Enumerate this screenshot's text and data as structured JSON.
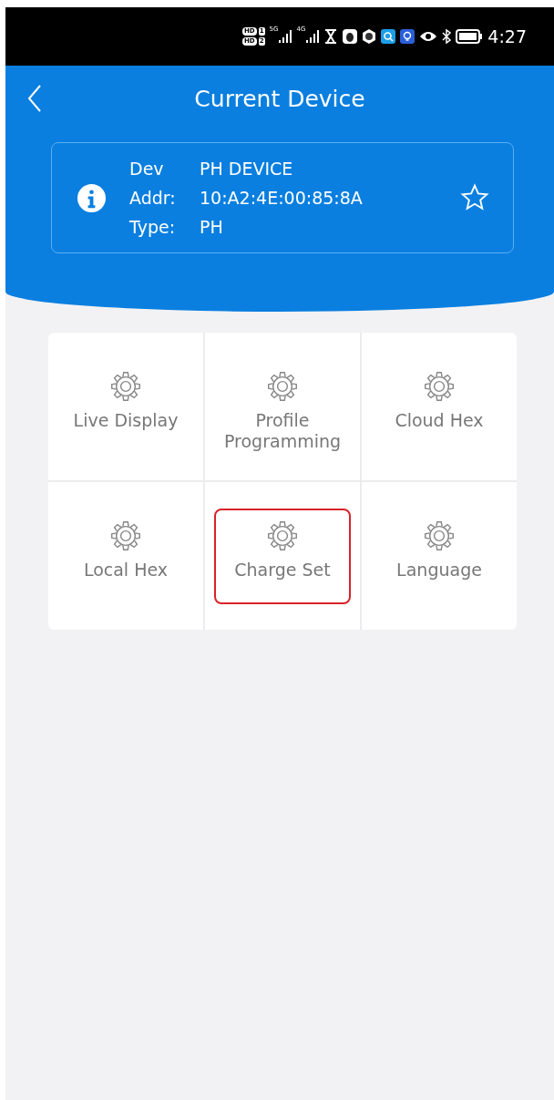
{
  "status_bar": {
    "sims": [
      {
        "badge": "HD",
        "slot": "1"
      },
      {
        "badge": "HD",
        "slot": "2"
      }
    ],
    "networks": [
      "5G",
      "4G"
    ],
    "time": "4:27"
  },
  "header": {
    "title": "Current Device"
  },
  "device": {
    "fields": [
      {
        "label": "Dev",
        "value": "PH DEVICE"
      },
      {
        "label": "Addr:",
        "value": "10:A2:4E:00:85:8A"
      },
      {
        "label": "Type:",
        "value": "PH"
      }
    ],
    "favorite": false
  },
  "menu": [
    {
      "label": "Live Display",
      "highlighted": false
    },
    {
      "label": "Profile Programming",
      "highlighted": false
    },
    {
      "label": "Cloud Hex",
      "highlighted": false
    },
    {
      "label": "Local Hex",
      "highlighted": false
    },
    {
      "label": "Charge Set",
      "highlighted": true
    },
    {
      "label": "Language",
      "highlighted": false
    }
  ]
}
